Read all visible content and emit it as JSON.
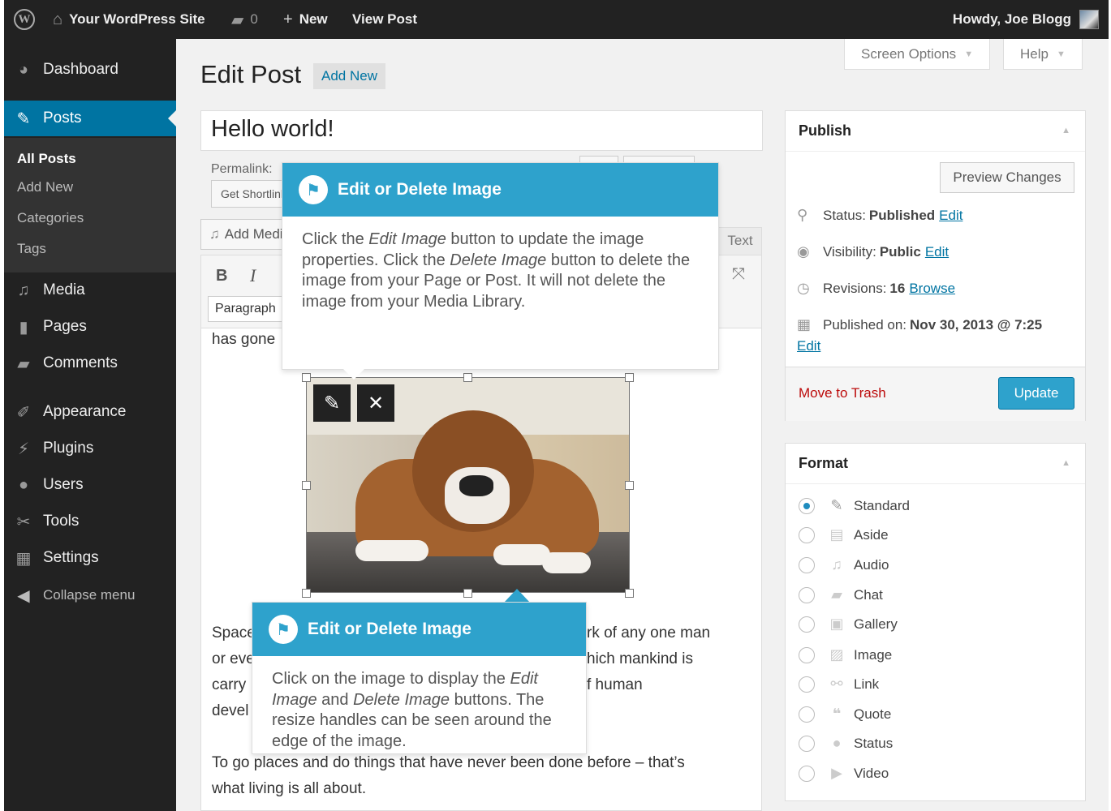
{
  "adminbar": {
    "wp_logo": "W",
    "site_name": "Your WordPress Site",
    "comments_count": "0",
    "new_label": "New",
    "view_post_label": "View Post",
    "howdy": "Howdy, Joe Blogg"
  },
  "sidebar": {
    "dashboard": "Dashboard",
    "posts": "Posts",
    "sub_all_posts": "All Posts",
    "sub_add_new": "Add New",
    "sub_categories": "Categories",
    "sub_tags": "Tags",
    "media": "Media",
    "pages": "Pages",
    "comments": "Comments",
    "appearance": "Appearance",
    "plugins": "Plugins",
    "users": "Users",
    "tools": "Tools",
    "settings": "Settings",
    "collapse": "Collapse menu"
  },
  "header": {
    "screen_options": "Screen Options",
    "help": "Help",
    "page_title": "Edit Post",
    "add_new": "Add New"
  },
  "editor": {
    "post_title": "Hello world!",
    "permalink_label": "Permalink:",
    "shortlink_btn": "Get Shortlink",
    "add_media": "Add Media",
    "text_tab": "Text",
    "bold": "B",
    "italic": "I",
    "format_value": "Paragraph",
    "line_1": "has gone",
    "line_1_end": ".",
    "para2_line1_start": "Space",
    "para2_line1_end": "rk of any one man",
    "para2_line2_start": "or eve",
    "para2_line2_end": "hich mankind is",
    "para2_line3_start": "carry",
    "para2_line3_end": "f human",
    "para2_line4_start": "devel",
    "para3_line1": "To go places and do things that have never been done before – that’s",
    "para3_line2": "what living is all about."
  },
  "pointer_top": {
    "title": "Edit or Delete Image",
    "body_1": "Click the ",
    "body_edit": "Edit Image",
    "body_2": " button to update the image properties. Click the ",
    "body_delete": "Delete Image",
    "body_3": " button to delete the image from your Page or Post. It will not delete the image from your Media Library."
  },
  "pointer_bottom": {
    "title": "Edit or Delete Image",
    "body_1": "Click on the image to display the ",
    "body_edit": "Edit Image",
    "body_2": " and ",
    "body_delete": "Delete Image",
    "body_3": " buttons. The resize handles can be seen around the edge of the image."
  },
  "publish": {
    "title": "Publish",
    "preview": "Preview Changes",
    "status_label": "Status: ",
    "status_value": "Published",
    "visibility_label": "Visibility: ",
    "visibility_value": "Public",
    "revisions_label": "Revisions: ",
    "revisions_value": "16",
    "browse": "Browse",
    "published_label": "Published on: ",
    "published_value": "Nov 30, 2013 @ 7:25",
    "edit": "Edit",
    "trash": "Move to Trash",
    "update": "Update"
  },
  "format": {
    "title": "Format",
    "options": [
      "Standard",
      "Aside",
      "Audio",
      "Chat",
      "Gallery",
      "Image",
      "Link",
      "Quote",
      "Status",
      "Video"
    ],
    "selected": "Standard"
  },
  "colors": {
    "accent": "#2ea2cc",
    "menu_active": "#0074a2",
    "adminbar": "#222222",
    "trash": "#bc0b0b"
  }
}
